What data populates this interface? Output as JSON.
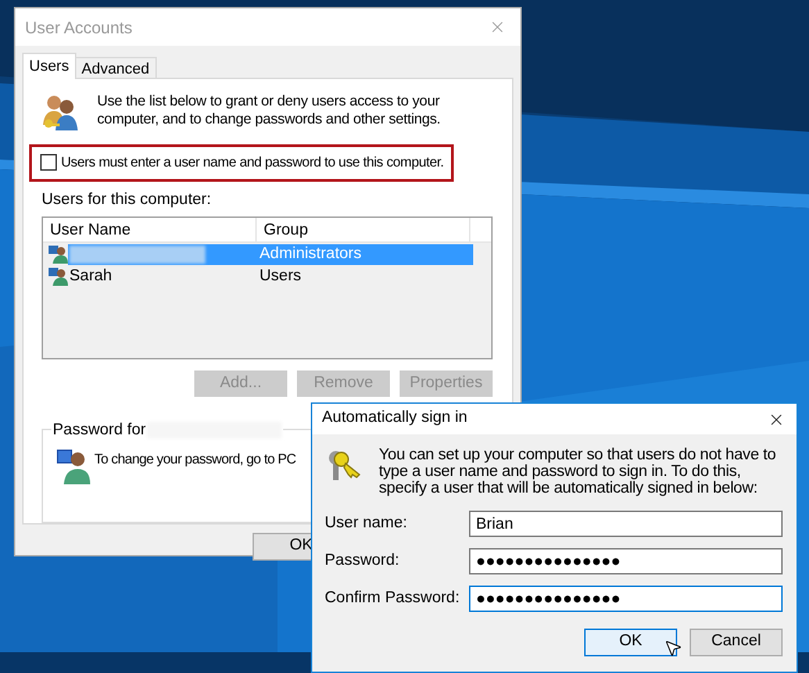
{
  "main_window": {
    "title": "User Accounts",
    "tabs": [
      {
        "label": "Users",
        "selected": true
      },
      {
        "label": "Advanced",
        "selected": false
      }
    ],
    "intro": "Use the list below to grant or deny users access to your computer, and to change passwords and other settings.",
    "require_password": {
      "label": "Users must enter a user name and password to use this computer.",
      "checked": false
    },
    "users_label": "Users for this computer:",
    "columns": [
      "User Name",
      "Group"
    ],
    "rows": [
      {
        "group": "Administrators",
        "selected": true
      },
      {
        "name": "Sarah",
        "group": "Users",
        "selected": false
      }
    ],
    "buttons": [
      {
        "label": "Add...",
        "disabled": true
      },
      {
        "label": "Remove",
        "disabled": true
      },
      {
        "label": "Properties",
        "disabled": true
      }
    ],
    "password_group": {
      "title": "Password for",
      "text": "To change your password, go to PC"
    },
    "ok_button": "OK"
  },
  "dialog": {
    "title": "Automatically sign in",
    "text": "You can set up your computer so that users do not have to type a user name and password to sign in. To do this, specify a user that will be automatically signed in below:",
    "fields": [
      {
        "label": "User name:",
        "value": "Brian",
        "focused": false
      },
      {
        "label": "Password:",
        "value": "●●●●●●●●●●●●●●●",
        "focused": false
      },
      {
        "label": "Confirm Password:",
        "value": "●●●●●●●●●●●●●●●",
        "focused": true
      }
    ],
    "buttons": [
      {
        "label": "OK",
        "default": true
      },
      {
        "label": "Cancel",
        "default": false
      }
    ]
  }
}
